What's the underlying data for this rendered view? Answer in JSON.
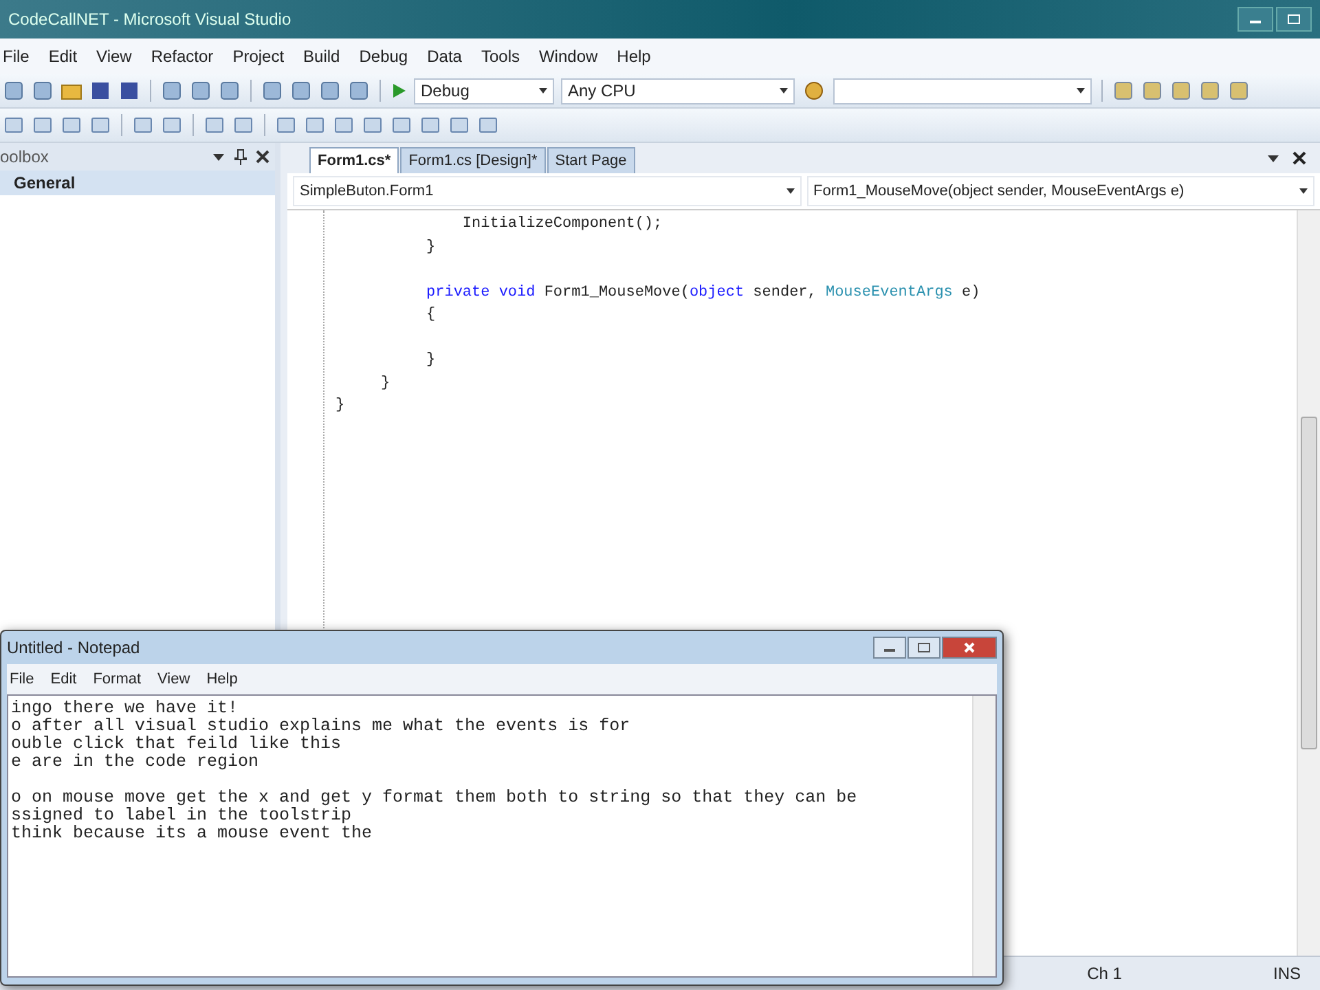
{
  "window": {
    "title": "CodeCallNET - Microsoft Visual Studio"
  },
  "menu": [
    "File",
    "Edit",
    "View",
    "Refactor",
    "Project",
    "Build",
    "Debug",
    "Data",
    "Tools",
    "Window",
    "Help"
  ],
  "toolbar": {
    "configuration": "Debug",
    "platform": "Any CPU"
  },
  "toolbox": {
    "title": "oolbox",
    "items": [
      {
        "label": "General",
        "selected": true
      }
    ]
  },
  "editor": {
    "tabs": [
      {
        "label": "Form1.cs*",
        "selected": true
      },
      {
        "label": "Form1.cs [Design]*",
        "selected": false
      },
      {
        "label": "Start Page",
        "selected": false
      }
    ],
    "class_combo": "SimpleButon.Form1",
    "member_combo": "Form1_MouseMove(object sender, MouseEventArgs e)",
    "lines": [
      [
        [
          {
            "text": "              InitializeComponent();",
            "kind": "plain"
          }
        ],
        [
          {
            "text": "          }",
            "kind": "plain"
          }
        ]
      ],
      [
        [
          {
            "text": "          private void",
            "kind": "keyword"
          },
          {
            "text": " Form1_MouseMove(",
            "kind": "plain"
          },
          {
            "text": "object",
            "kind": "keyword"
          },
          {
            "text": " sender, ",
            "kind": "plain"
          },
          {
            "text": "MouseEventArgs",
            "kind": "type"
          },
          {
            "text": " e)",
            "kind": "plain"
          }
        ],
        [
          {
            "text": "          {",
            "kind": "plain"
          }
        ]
      ],
      [
        [
          {
            "text": "          }",
            "kind": "plain"
          }
        ],
        [
          {
            "text": "     }",
            "kind": "plain"
          }
        ],
        [
          {
            "text": "}",
            "kind": "plain"
          }
        ]
      ]
    ]
  },
  "status_bar": [
    "Ch 1",
    "INS"
  ],
  "notepad": {
    "title": "Untitled - Notepad",
    "menu": [
      "File",
      "Edit",
      "Format",
      "View",
      "Help"
    ],
    "lines": [
      [
        "ingo there we have it!",
        "o after all visual studio explains me what the events is for",
        "ouble click that feild like this",
        "e are in the code region"
      ],
      [
        "o on mouse move get the x and get y format them both to string so that they can be",
        "ssigned to label in the toolstrip",
        "think because its a mouse event the"
      ]
    ]
  }
}
